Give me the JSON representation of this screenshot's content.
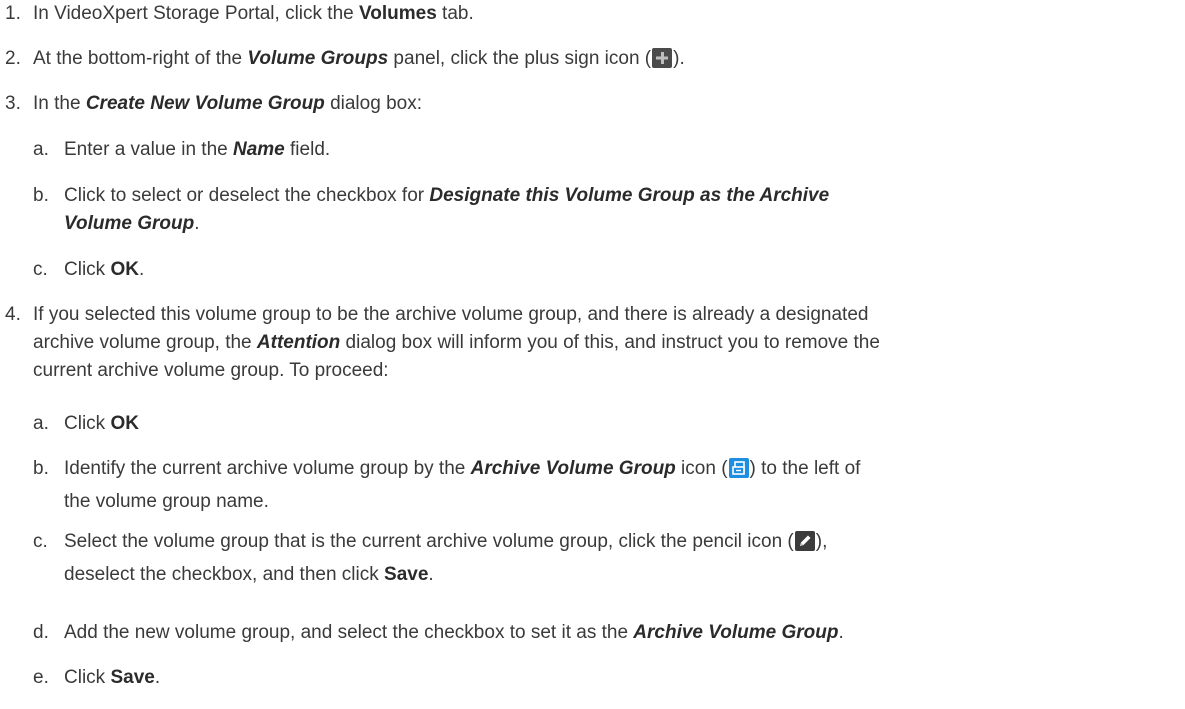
{
  "steps": [
    {
      "num": "1.",
      "parts": [
        {
          "t": "text",
          "v": "In VideoXpert Storage Portal, click the "
        },
        {
          "t": "bold",
          "v": "Volumes"
        },
        {
          "t": "text",
          "v": " tab."
        }
      ]
    },
    {
      "num": "2.",
      "parts": [
        {
          "t": "text",
          "v": "At the bottom-right of the "
        },
        {
          "t": "ital",
          "v": "Volume Groups"
        },
        {
          "t": "text",
          "v": " panel, click the plus sign icon ("
        },
        {
          "t": "icon",
          "v": "plus-icon"
        },
        {
          "t": "text",
          "v": ")."
        }
      ]
    },
    {
      "num": "3.",
      "parts": [
        {
          "t": "text",
          "v": "In the "
        },
        {
          "t": "ital",
          "v": "Create New Volume Group"
        },
        {
          "t": "text",
          "v": " dialog box:"
        }
      ],
      "subs": [
        {
          "num": "a.",
          "parts": [
            {
              "t": "text",
              "v": "Enter a value in the "
            },
            {
              "t": "ital",
              "v": "Name"
            },
            {
              "t": "text",
              "v": " field."
            }
          ]
        },
        {
          "num": "b.",
          "parts": [
            {
              "t": "text",
              "v": "Click to select or deselect the checkbox for "
            },
            {
              "t": "ital",
              "v": "Designate this Volume Group as the Archive"
            },
            {
              "t": "br"
            },
            {
              "t": "ital",
              "v": "Volume Group"
            },
            {
              "t": "text",
              "v": "."
            }
          ]
        },
        {
          "num": "c.",
          "parts": [
            {
              "t": "text",
              "v": "Click "
            },
            {
              "t": "bold",
              "v": "OK"
            },
            {
              "t": "text",
              "v": "."
            }
          ]
        }
      ]
    },
    {
      "num": "4.",
      "parts": [
        {
          "t": "text",
          "v": "If you selected this volume group to be the archive volume group, and there is already a designated"
        },
        {
          "t": "br"
        },
        {
          "t": "text",
          "v": "archive volume group, the "
        },
        {
          "t": "ital",
          "v": "Attention"
        },
        {
          "t": "text",
          "v": " dialog box will inform you of this, and instruct you to remove the"
        },
        {
          "t": "br"
        },
        {
          "t": "text",
          "v": "current archive volume group. To proceed:"
        }
      ],
      "subs": [
        {
          "num": "a.",
          "parts": [
            {
              "t": "text",
              "v": "Click "
            },
            {
              "t": "bold",
              "v": "OK"
            }
          ]
        },
        {
          "num": "b.",
          "tall": true,
          "parts": [
            {
              "t": "text",
              "v": "Identify the current archive volume group by the "
            },
            {
              "t": "ital",
              "v": "Archive Volume Group"
            },
            {
              "t": "text",
              "v": " icon ("
            },
            {
              "t": "icon",
              "v": "archive-icon"
            },
            {
              "t": "text",
              "v": ") to the left of"
            },
            {
              "t": "br"
            },
            {
              "t": "text",
              "v": "the volume group name."
            }
          ]
        },
        {
          "num": "c.",
          "tall": true,
          "parts": [
            {
              "t": "text",
              "v": "Select the volume group that is the current archive volume group, click the pencil icon ("
            },
            {
              "t": "icon",
              "v": "pencil-icon"
            },
            {
              "t": "text",
              "v": "),"
            },
            {
              "t": "br"
            },
            {
              "t": "text",
              "v": "deselect the checkbox, and then click "
            },
            {
              "t": "bold",
              "v": "Save"
            },
            {
              "t": "text",
              "v": "."
            }
          ]
        },
        {
          "num": "d.",
          "parts": [
            {
              "t": "text",
              "v": "Add the new volume group, and select the checkbox to set it as the "
            },
            {
              "t": "ital",
              "v": "Archive Volume Group"
            },
            {
              "t": "text",
              "v": "."
            }
          ]
        },
        {
          "num": "e.",
          "parts": [
            {
              "t": "text",
              "v": "Click "
            },
            {
              "t": "bold",
              "v": "Save"
            },
            {
              "t": "text",
              "v": "."
            }
          ]
        }
      ]
    }
  ],
  "colors": {
    "text": "#3a3a3a",
    "plus_icon_bg": "#4a4a4a",
    "archive_icon_bg": "#1e8fe0",
    "pencil_icon_bg": "#3c3c3c"
  }
}
